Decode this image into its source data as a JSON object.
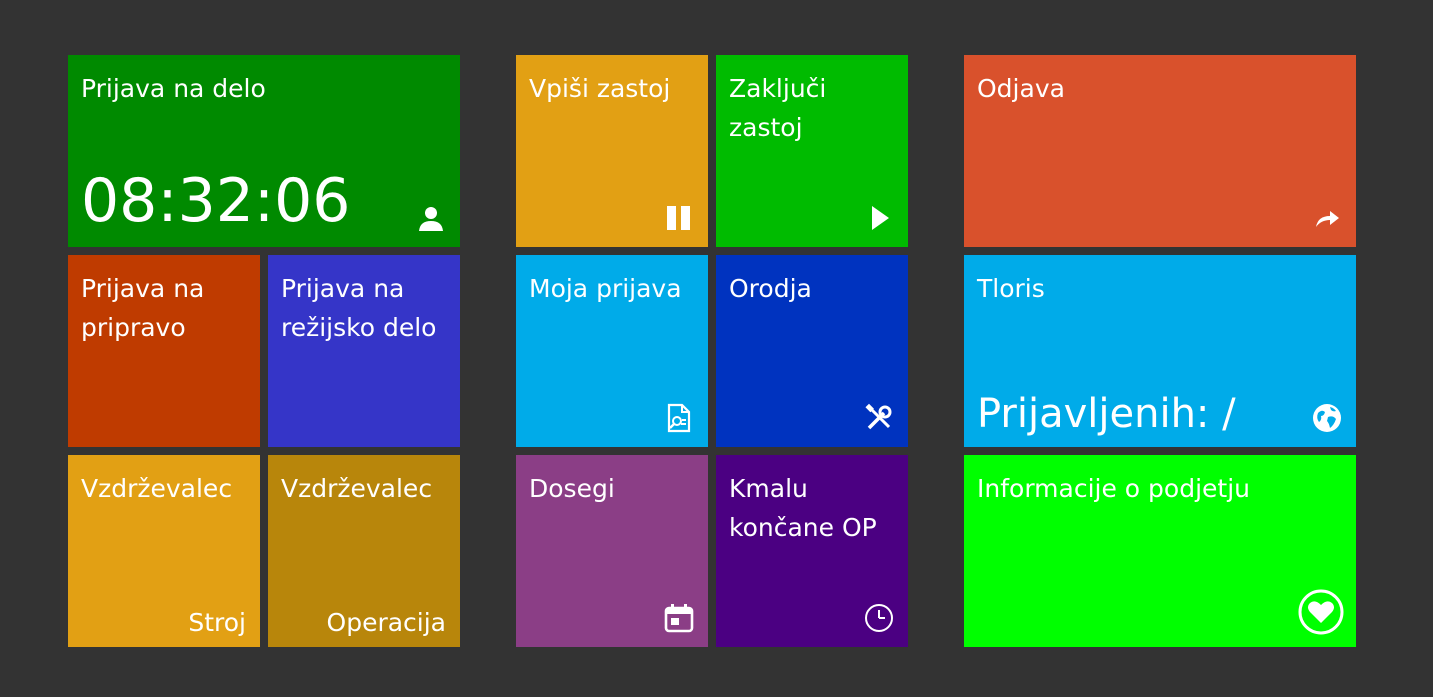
{
  "tiles": {
    "prijava_na_delo": {
      "title": "Prijava na delo",
      "time": "08:32:06",
      "icon": "user-icon",
      "color": "#008a00"
    },
    "prijava_na_pripravo": {
      "title": "Prijava na\npripravo",
      "color": "#bf3b00"
    },
    "prijava_na_rezijsko_delo": {
      "title": "Prijava na\nrežijsko delo",
      "color": "#3535c8"
    },
    "vzdrzevalec_stroj": {
      "title": "Vzdrževalec",
      "sub": "Stroj",
      "color": "#e2a014"
    },
    "vzdrzevalec_operacija": {
      "title": "Vzdrževalec",
      "sub": "Operacija",
      "color": "#b8860b"
    },
    "vpisi_zastoj": {
      "title": "Vpiši zastoj",
      "icon": "pause-icon",
      "color": "#e2a014"
    },
    "zakljuci_zastoj": {
      "title": "Zaključi\nzastoj",
      "icon": "play-icon",
      "color": "#00bb00"
    },
    "moja_prijava": {
      "title": "Moja prijava",
      "icon": "document-search-icon",
      "color": "#00abe9"
    },
    "orodja": {
      "title": "Orodja",
      "icon": "tools-icon",
      "color": "#0033bf"
    },
    "dosegi": {
      "title": "Dosegi",
      "icon": "calendar-icon",
      "color": "#8b3e86"
    },
    "kmalu_koncane_op": {
      "title": "Kmalu\nkončane OP",
      "icon": "clock-icon",
      "color": "#4b0082"
    },
    "odjava": {
      "title": "Odjava",
      "icon": "share-arrow-icon",
      "color": "#d9512c"
    },
    "tloris": {
      "title": "Tloris",
      "status": "Prijavljenih: /",
      "icon": "globe-icon",
      "color": "#00abe9"
    },
    "informacije": {
      "title": "Informacije o podjetju",
      "icon": "heart-icon",
      "color": "#00ff00"
    }
  }
}
